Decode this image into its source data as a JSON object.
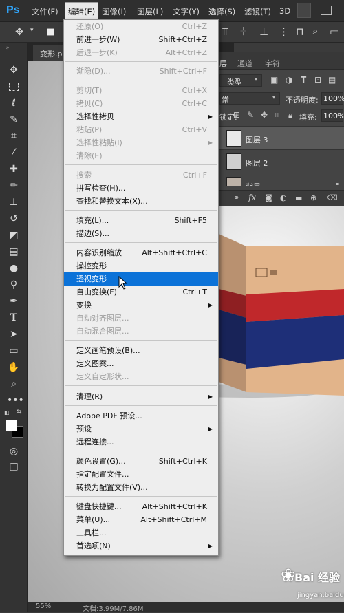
{
  "app": {
    "logo": "Ps",
    "menus": [
      "文件(F)",
      "编辑(E)",
      "图像(I)",
      "图层(L)",
      "文字(Y)",
      "选择(S)",
      "滤镜(T)",
      "3D"
    ]
  },
  "document": {
    "tab_label": "变形.psd",
    "zoom": "55%",
    "doc_info": "文档:3.99M/7.86M"
  },
  "panel": {
    "tabs": [
      "层",
      "通道",
      "字符"
    ],
    "kind_label": "类型",
    "blend_mode": "常",
    "opacity_label": "不透明度:",
    "opacity_value": "100%",
    "lock_label": "锁定:",
    "fill_label": "填充:",
    "fill_value": "100%",
    "layers": [
      {
        "name": "图层 3"
      },
      {
        "name": "图层 2"
      },
      {
        "name": "背景"
      }
    ]
  },
  "edit_menu": {
    "items": [
      {
        "label": "还原(O)",
        "shortcut": "Ctrl+Z",
        "disabled": true
      },
      {
        "label": "前进一步(W)",
        "shortcut": "Shift+Ctrl+Z",
        "disabled": false
      },
      {
        "label": "后退一步(K)",
        "shortcut": "Alt+Ctrl+Z",
        "disabled": true
      },
      {
        "label": "渐隐(D)...",
        "shortcut": "Shift+Ctrl+F",
        "disabled": true
      },
      {
        "label": "剪切(T)",
        "shortcut": "Ctrl+X",
        "disabled": true
      },
      {
        "label": "拷贝(C)",
        "shortcut": "Ctrl+C",
        "disabled": true
      },
      {
        "label": "选择性拷贝",
        "shortcut": "",
        "disabled": false,
        "submenu": true
      },
      {
        "label": "粘贴(P)",
        "shortcut": "Ctrl+V",
        "disabled": true
      },
      {
        "label": "选择性粘贴(I)",
        "shortcut": "",
        "disabled": true,
        "submenu": true
      },
      {
        "label": "清除(E)",
        "shortcut": "",
        "disabled": true
      },
      {
        "label": "搜索",
        "shortcut": "Ctrl+F",
        "disabled": true
      },
      {
        "label": "拼写检查(H)...",
        "shortcut": "",
        "disabled": false
      },
      {
        "label": "查找和替换文本(X)...",
        "shortcut": "",
        "disabled": false
      },
      {
        "label": "填充(L)...",
        "shortcut": "Shift+F5",
        "disabled": false
      },
      {
        "label": "描边(S)...",
        "shortcut": "",
        "disabled": false
      },
      {
        "label": "内容识别缩放",
        "shortcut": "Alt+Shift+Ctrl+C",
        "disabled": false
      },
      {
        "label": "操控变形",
        "shortcut": "",
        "disabled": false
      },
      {
        "label": "透视变形",
        "shortcut": "",
        "disabled": false,
        "selected": true
      },
      {
        "label": "自由变换(F)",
        "shortcut": "Ctrl+T",
        "disabled": false
      },
      {
        "label": "变换",
        "shortcut": "",
        "disabled": false,
        "submenu": true
      },
      {
        "label": "自动对齐图层...",
        "shortcut": "",
        "disabled": true
      },
      {
        "label": "自动混合图层...",
        "shortcut": "",
        "disabled": true
      },
      {
        "label": "定义画笔预设(B)...",
        "shortcut": "",
        "disabled": false
      },
      {
        "label": "定义图案...",
        "shortcut": "",
        "disabled": false
      },
      {
        "label": "定义自定形状...",
        "shortcut": "",
        "disabled": true
      },
      {
        "label": "清理(R)",
        "shortcut": "",
        "disabled": false,
        "submenu": true
      },
      {
        "label": "Adobe PDF 预设...",
        "shortcut": "",
        "disabled": false
      },
      {
        "label": "预设",
        "shortcut": "",
        "disabled": false,
        "submenu": true
      },
      {
        "label": "远程连接...",
        "shortcut": "",
        "disabled": false
      },
      {
        "label": "颜色设置(G)...",
        "shortcut": "Shift+Ctrl+K",
        "disabled": false
      },
      {
        "label": "指定配置文件...",
        "shortcut": "",
        "disabled": false
      },
      {
        "label": "转换为配置文件(V)...",
        "shortcut": "",
        "disabled": false
      },
      {
        "label": "键盘快捷键...",
        "shortcut": "Alt+Shift+Ctrl+K",
        "disabled": false
      },
      {
        "label": "菜单(U)...",
        "shortcut": "Alt+Shift+Ctrl+M",
        "disabled": false
      },
      {
        "label": "工具栏...",
        "shortcut": "",
        "disabled": false
      },
      {
        "label": "首选项(N)",
        "shortcut": "",
        "disabled": false,
        "submenu": true
      }
    ]
  },
  "watermark": {
    "brand": "Bai 经验",
    "sub": "jingyan.baidu.com"
  },
  "colors": {
    "accent": "#0b72d8",
    "box_tan": "#e2b48a",
    "box_red": "#c0282b",
    "box_blue": "#1e2f78"
  }
}
